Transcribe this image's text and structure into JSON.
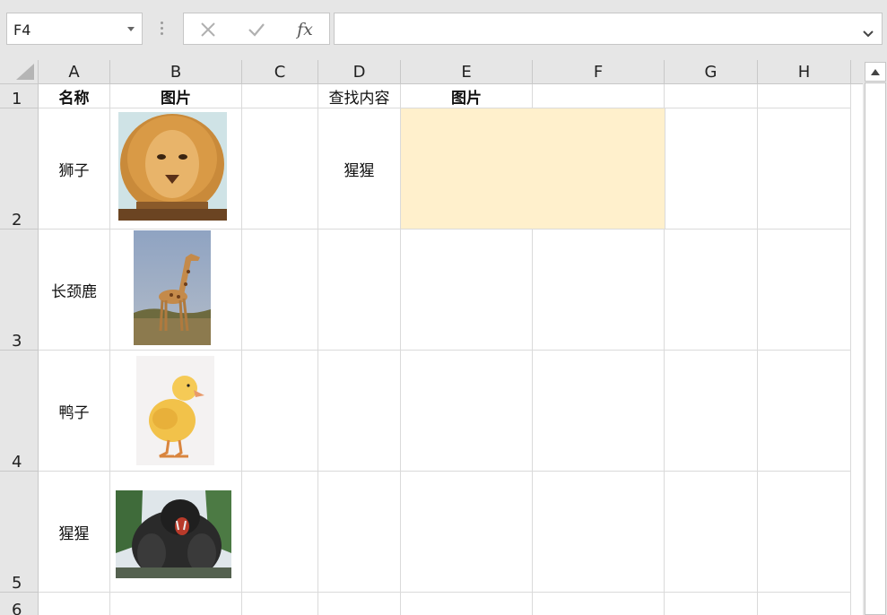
{
  "name_box": {
    "value": "F4"
  },
  "formula_bar": {
    "value": "",
    "fx_label": "fx"
  },
  "icons": {
    "cancel": "close-icon",
    "enter": "check-icon",
    "function": "fx-icon",
    "expand": "chevron-down-icon",
    "scroll_up": "triangle-up-icon"
  },
  "columns": [
    "A",
    "B",
    "C",
    "D",
    "E",
    "F",
    "G",
    "H"
  ],
  "rows": [
    "1",
    "2",
    "3",
    "4",
    "5",
    "6"
  ],
  "cells": {
    "A1": "名称",
    "B1": "图片",
    "D1": "查找内容",
    "E1": "图片",
    "A2": "狮子",
    "D2": "猩猩",
    "A3": "长颈鹿",
    "A4": "鸭子",
    "A5": "猩猩"
  },
  "pictures": [
    "lion-picture",
    "giraffe-picture",
    "duckling-picture",
    "gorilla-picture"
  ],
  "colors": {
    "highlight": "#fff0cc",
    "header_bg": "#e6e6e6",
    "gridline": "#dadada"
  }
}
